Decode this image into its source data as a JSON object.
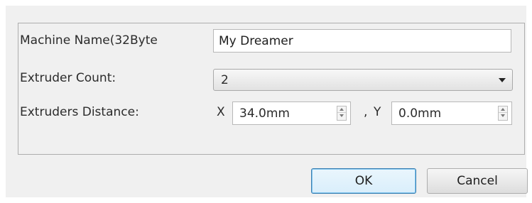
{
  "form": {
    "machine_name_label": "Machine Name(32Byte",
    "machine_name_value": "My Dreamer",
    "extruder_count_label": "Extruder Count:",
    "extruder_count_value": "2",
    "distance_label": "Extruders Distance:",
    "x_label": "X",
    "x_value": "34.0mm",
    "separator": ",",
    "y_label": "Y",
    "y_value": "0.0mm"
  },
  "buttons": {
    "ok_label": "OK",
    "cancel_label": "Cancel"
  },
  "icons": {
    "dropdown": "chevron-down-icon",
    "spin_up": "spin-up-icon",
    "spin_down": "spin-down-icon"
  },
  "colors": {
    "dialog_bg": "#f0f0f0",
    "ok_border": "#3c7fb1"
  }
}
